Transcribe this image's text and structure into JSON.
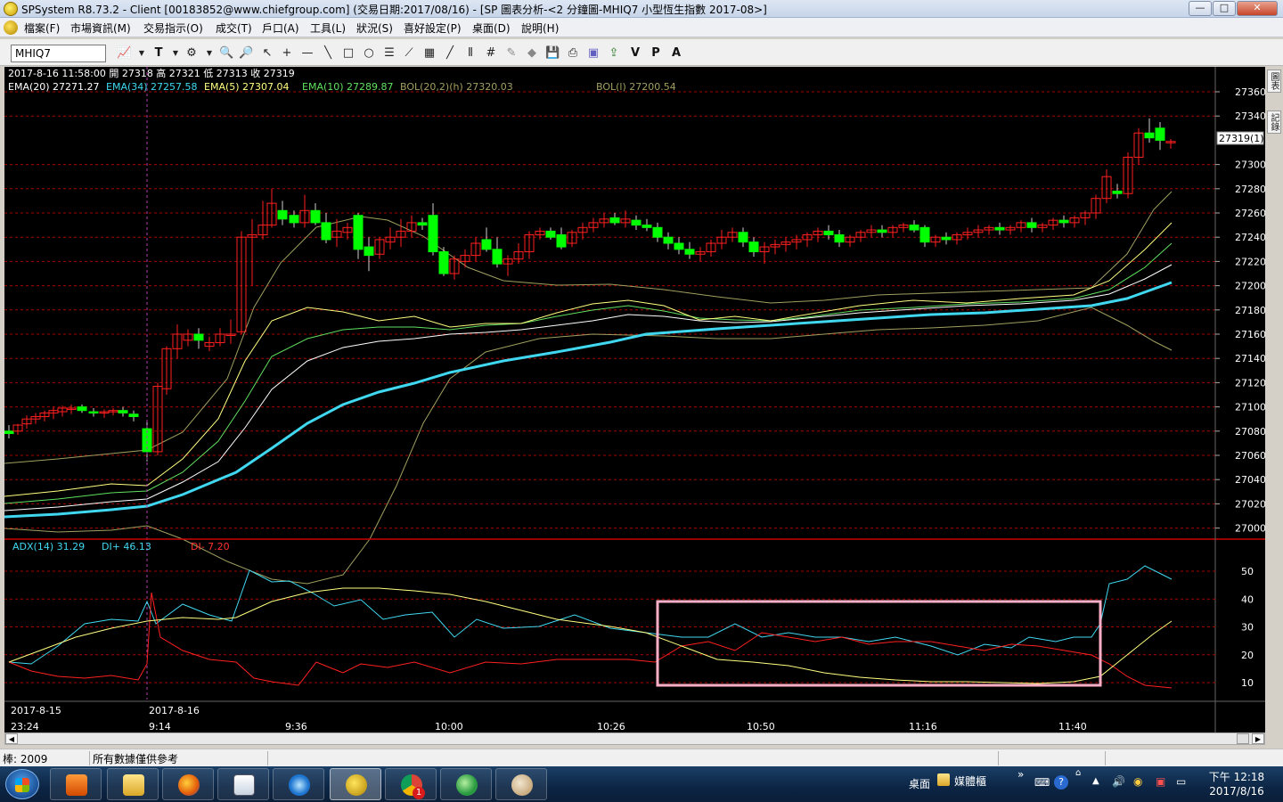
{
  "window": {
    "title": "SPSystem R8.73.2 - Client [00183852@www.chiefgroup.com] (交易日期:2017/08/16) - [SP 圖表分析-<2 分鐘圖-MHIQ7 小型恆生指數 2017-08>]",
    "min_label": "—",
    "max_label": "□",
    "close_label": "✕"
  },
  "menu": {
    "items": [
      {
        "label": "檔案(F)"
      },
      {
        "label": "市場資訊(M)"
      },
      {
        "label": "交易指示(O)"
      },
      {
        "label": "成交(T)"
      },
      {
        "label": "戶口(A)"
      },
      {
        "label": "工具(L)"
      },
      {
        "label": "狀況(S)"
      },
      {
        "label": "喜好設定(P)"
      },
      {
        "label": "桌面(D)"
      },
      {
        "label": "說明(H)"
      }
    ],
    "mdi": [
      "_",
      "▫",
      "×"
    ]
  },
  "toolbar": {
    "symbol_value": "MHIQ7",
    "icons": [
      "chart-type-icon",
      "dropdown-icon",
      "text-tool-icon",
      "dropdown-icon",
      "indicator-icon",
      "dropdown-icon",
      "zoom-in-icon",
      "zoom-out-icon",
      "pointer-icon",
      "crosshair-icon",
      "hline-icon",
      "trendline-icon",
      "rectangle-icon",
      "ellipse-icon",
      "channel-icon",
      "fan-icon",
      "fibonacci-icon",
      "line-icon",
      "grid-icon",
      "grid2-icon",
      "eraser-icon",
      "eraser2-icon",
      "save-icon",
      "print-icon",
      "image-icon",
      "export-icon",
      "v-icon",
      "p-icon",
      "a-icon"
    ],
    "letters": {
      "t": "T",
      "v": "V",
      "p": "P",
      "a": "A"
    }
  },
  "chart": {
    "info_line": "2017-8-16 11:58:00 開 27318 高 27321 低 27313 收 27319",
    "legend": [
      {
        "text": "EMA(20) 27271.27",
        "color": "#ffffff"
      },
      {
        "text": "EMA(34) 27257.58",
        "color": "#40d8f0"
      },
      {
        "text": "EMA(5) 27307.04",
        "color": "#ffff80"
      },
      {
        "text": "EMA(10) 27289.87",
        "color": "#60e060"
      },
      {
        "text": "BOL(20,2)(h) 27320.03",
        "color": "#a0a060"
      },
      {
        "text": "BOL(l) 27200.54",
        "color": "#a0a060"
      }
    ],
    "price_ticks": [
      "27360",
      "27340",
      "27300",
      "27280",
      "27260",
      "27240",
      "27220",
      "27200",
      "27180",
      "27160",
      "27140",
      "27120",
      "27100",
      "27080",
      "27060",
      "27040",
      "27020",
      "27000"
    ],
    "last_price_tag": "27319(1)",
    "adx_legend": [
      {
        "text": "ADX(14) 31.29",
        "color": "#40d8f0"
      },
      {
        "text": "DI+ 46.13",
        "color": "#40d8f0"
      },
      {
        "text": "DI- 7.20",
        "color": "#ff3030"
      }
    ],
    "adx_ticks": [
      "50",
      "40",
      "30",
      "20",
      "10"
    ],
    "date_labels": [
      "2017-8-15",
      "2017-8-16"
    ],
    "time_labels": [
      "23:24",
      "9:14",
      "9:36",
      "10:00",
      "10:26",
      "10:50",
      "11:16",
      "11:40"
    ]
  },
  "side_tabs": [
    "圖表",
    "記錄"
  ],
  "statusbar": {
    "bars": "棒: 2009",
    "note": "所有數據僅供參考"
  },
  "taskbar": {
    "desktop_label": "桌面",
    "media_label": "媒體櫃",
    "expand": "»",
    "time": "下午 12:18",
    "date": "2017/8/16",
    "badge": "1"
  },
  "colors": {
    "bull": "#ff2020",
    "bear": "#00ff00",
    "ema20": "#ffffff",
    "ema34": "#40d8f0",
    "ema5": "#ffff80",
    "ema10": "#60e060",
    "bol": "#a0a060",
    "grid": "#aa0000",
    "highlight_box": "#ffb0c8"
  }
}
